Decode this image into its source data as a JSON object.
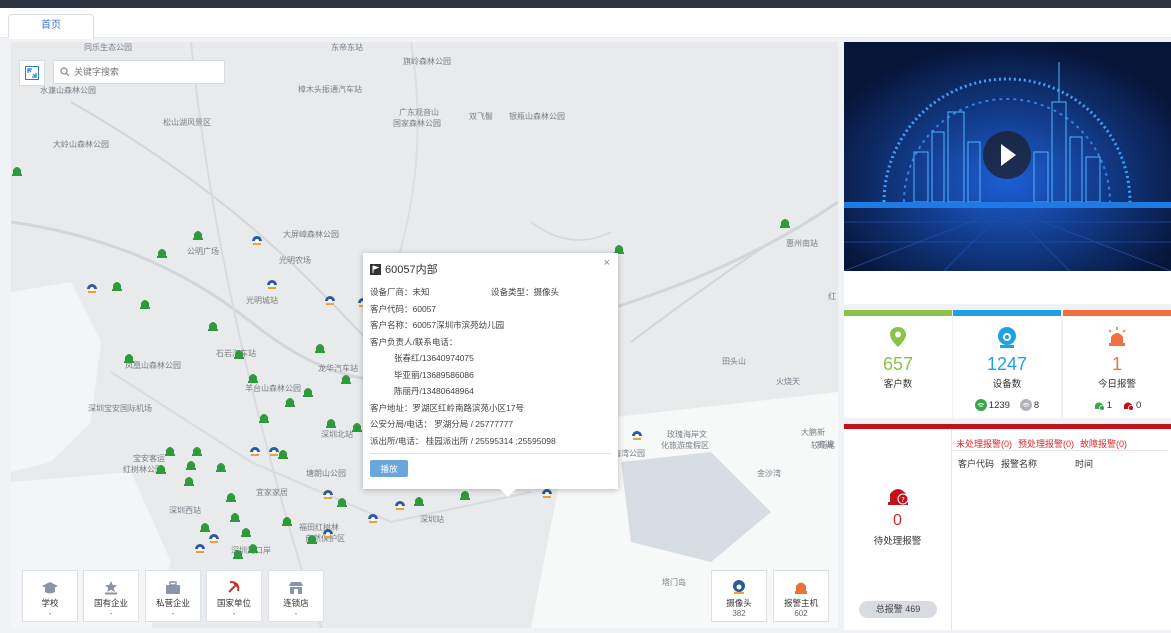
{
  "tabs": [
    {
      "label": "首页"
    }
  ],
  "search": {
    "placeholder": "关键字搜索"
  },
  "map_labels": [
    "同乐生态公园",
    "东帝东站",
    "旗岭森林公园",
    "水濂山森林公园",
    "樟木头振通汽车站",
    "广东观音山",
    "国家森林公园",
    "双飞髻",
    "银瓶山森林公园",
    "松山湖风景区",
    "大岭山森林公园",
    "大屏嶂森林公园",
    "公明广场",
    "光明农场",
    "惠州南站",
    "光明城站",
    "石岩汽车站",
    "凤凰山森林公园",
    "羊台山森林公园",
    "龙华汽车站",
    "田头山",
    "火烧天",
    "深圳宝安国际机场",
    "深圳北站",
    "玫瑰海岸文",
    "化旅游度假区",
    "大鹏新",
    "海湾公园",
    "官湖",
    "宝安客运",
    "红树林公园",
    "塘朗山公园",
    "宜家家居",
    "深圳西站",
    "福田红树林",
    "自然保护区",
    "深圳湾口岸",
    "深圳站",
    "塔门岛",
    "金沙湾",
    "较场尾",
    "红"
  ],
  "popup": {
    "title": "60057内部",
    "vendor_label": "设备厂商：未知",
    "device_type_label": "设备类型：摄像头",
    "customer_code": "客户代码：60057",
    "customer_name": "客户名称：60057深圳市滨苑幼儿园",
    "contacts_label": "客户负责人/联系电话：",
    "contacts": [
      "张春红/13640974075",
      "毕亚丽/13689586086",
      "陈丽丹/13480648964"
    ],
    "address": "客户地址：罗湖区红岭南路滨苑小区17号",
    "police": "公安分局/电话：  罗湖分局 / 25777777",
    "station": "派出所/电话：  桂园派出所 / 25595314 ;25595098",
    "play_label": "播放",
    "close": "×"
  },
  "legend": [
    {
      "label": "学校",
      "count": "-"
    },
    {
      "label": "国有企业",
      "count": "-"
    },
    {
      "label": "私营企业",
      "count": "-"
    },
    {
      "label": "国家单位",
      "count": "-"
    },
    {
      "label": "连锁店",
      "count": "-"
    },
    {
      "label": "摄像头",
      "count": "382"
    },
    {
      "label": "报警主机",
      "count": "602"
    }
  ],
  "stats": {
    "customers": {
      "value": "657",
      "label": "客户数",
      "color": "#8bc34a"
    },
    "devices": {
      "value": "1247",
      "label": "设备数",
      "online": "1239",
      "offline": "8",
      "color": "#1ea2e6"
    },
    "alarms_today": {
      "value": "1",
      "label": "今日报警",
      "handled": "1",
      "unhandled": "0",
      "color": "#f26f3f"
    }
  },
  "pending": {
    "value": "0",
    "label": "待处理报警",
    "total": "总报警 469"
  },
  "alarm_tabs": [
    "未处理报警(0)",
    "预处理报警(0)",
    "故障报警(0)"
  ],
  "alarm_columns": [
    "客户代码",
    "报警名称",
    "时间"
  ],
  "colors": {
    "green_marker": "#2f9a3a",
    "blue_marker": "#2d5a9a",
    "alarm_red": "#c0121b"
  }
}
